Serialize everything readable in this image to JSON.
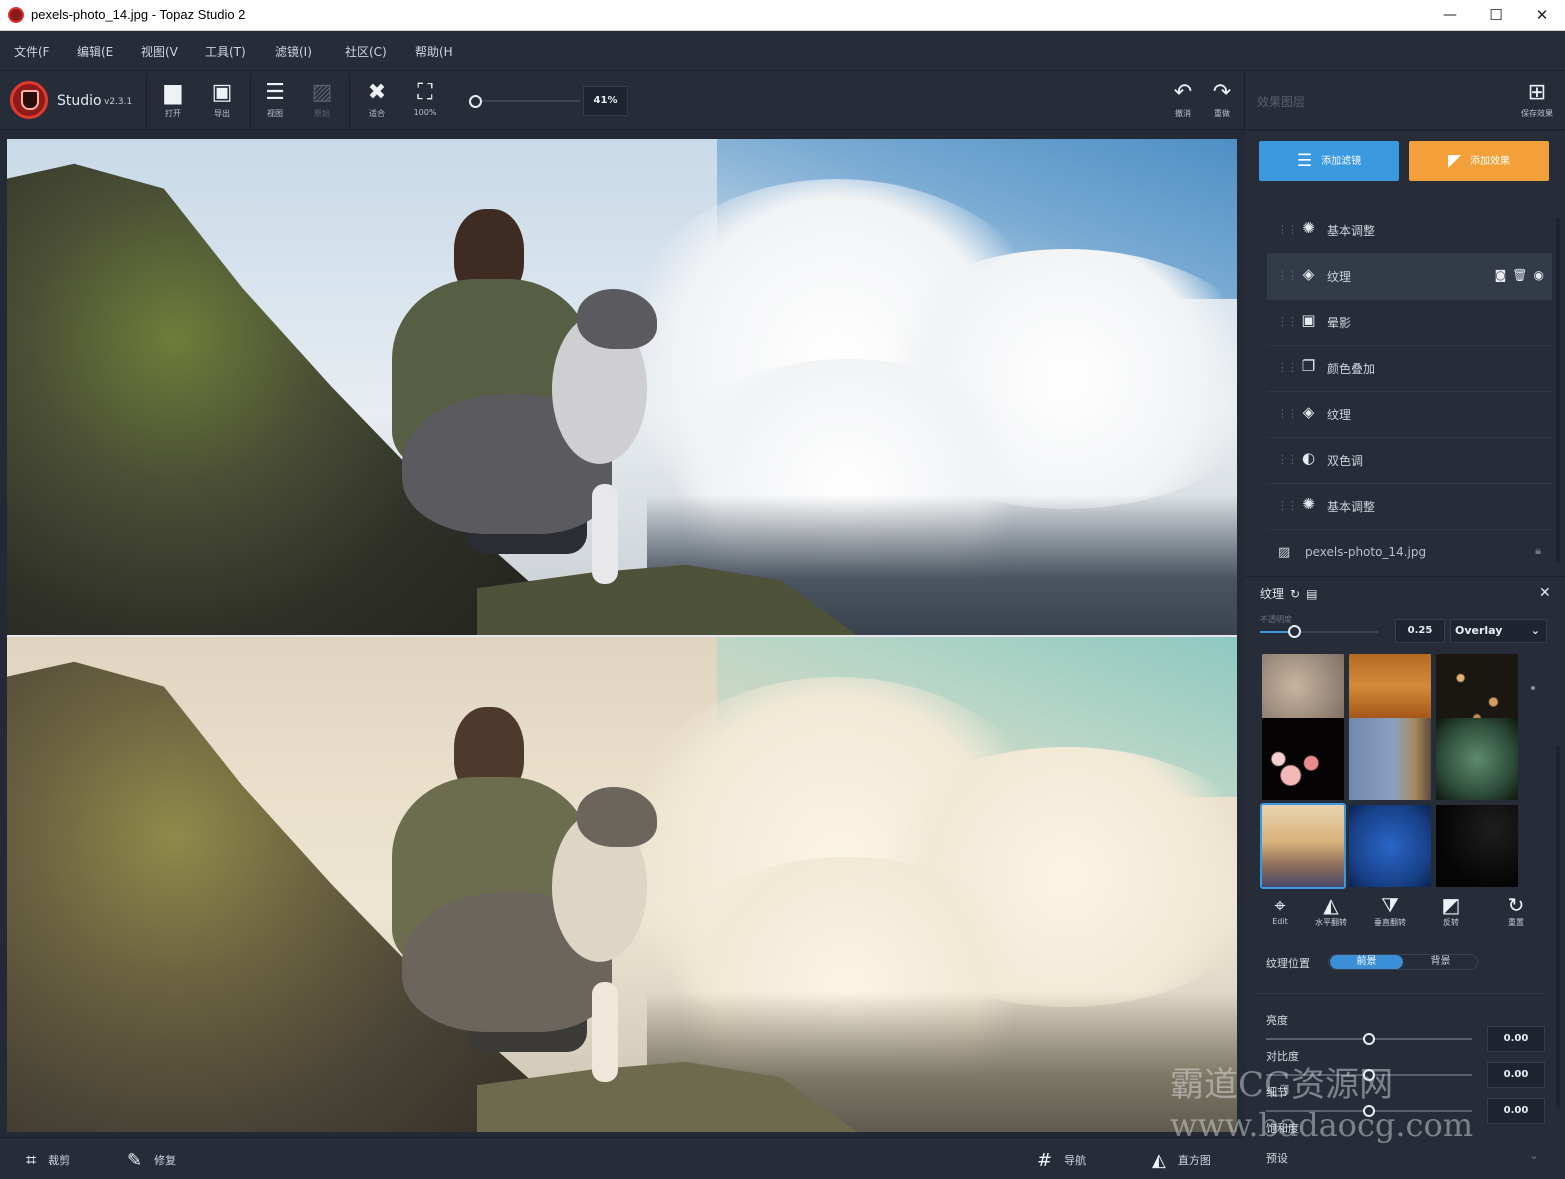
{
  "window": {
    "title": "pexels-photo_14.jpg - Topaz Studio 2",
    "minimize": "—",
    "maximize": "☐",
    "close": "✕"
  },
  "menu": [
    "文件(F",
    "编辑(E",
    "视图(V",
    "工具(T)",
    "滤镜(I)",
    "社区(C)",
    "帮助(H"
  ],
  "toolbar": {
    "app_name": "Studio",
    "version": "v2.3.1",
    "open": "打开",
    "export": "导出",
    "view": "视图",
    "compare": "原始",
    "fit": "适合",
    "actual": "100%",
    "zoom_value": "41%",
    "zoom_percent": 41,
    "undo": "撤消",
    "redo": "重做",
    "layers_title": "效果图层",
    "save_effect": "保存效果"
  },
  "panel": {
    "add_filter": "添加滤镜",
    "add_effect": "添加效果",
    "layers": [
      {
        "name": "基本调整",
        "icon": "aperture-icon",
        "selected": false
      },
      {
        "name": "纹理",
        "icon": "layers-icon",
        "selected": true
      },
      {
        "name": "晕影",
        "icon": "vignette-icon",
        "selected": false
      },
      {
        "name": "颜色叠加",
        "icon": "overlay-icon",
        "selected": false
      },
      {
        "name": "纹理",
        "icon": "layers-icon",
        "selected": false
      },
      {
        "name": "双色调",
        "icon": "duotone-icon",
        "selected": false
      },
      {
        "name": "基本调整",
        "icon": "aperture-icon",
        "selected": false
      }
    ],
    "base_layer": "pexels-photo_14.jpg"
  },
  "texture": {
    "title": "纹理",
    "opacity_label": "不透明度",
    "opacity_value": "0.25",
    "opacity": 0.25,
    "blend_mode": "Overlay",
    "tools": {
      "edit": "Edit",
      "flip_h": "水平翻转",
      "flip_v": "垂直翻转",
      "invert": "反转",
      "reset": "重置"
    },
    "position_label": "纹理位置",
    "position_fg": "前景",
    "position_bg": "背景",
    "adjustments": [
      {
        "label": "亮度",
        "value": "0.00"
      },
      {
        "label": "对比度",
        "value": "0.00"
      },
      {
        "label": "细节",
        "value": "0.00"
      },
      {
        "label": "饱和度",
        "value": ""
      }
    ],
    "presets_label": "预设"
  },
  "bottom": {
    "crop": "裁剪",
    "repair": "修复",
    "navigate": "导航",
    "histogram": "直方图"
  },
  "watermark": {
    "name": "霸道CG资源网",
    "url": "www.badaocg.com"
  },
  "colors": {
    "accent_blue": "#3b99e0",
    "accent_orange": "#f3a03a",
    "panel_bg": "#262d39",
    "brand_red": "#e23a2c"
  }
}
